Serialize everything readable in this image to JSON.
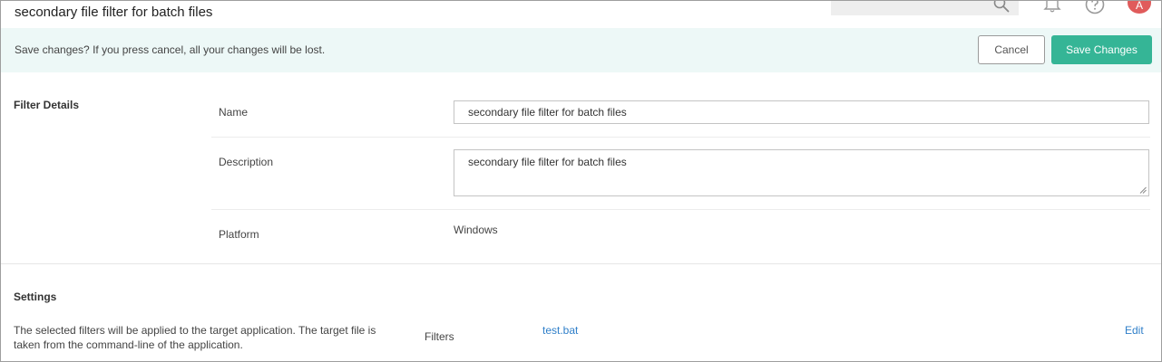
{
  "header": {
    "title": "secondary file filter for batch files",
    "avatar_initial": "A"
  },
  "save_bar": {
    "message": "Save changes? If you press cancel, all your changes will be lost.",
    "cancel_label": "Cancel",
    "save_label": "Save Changes",
    "save_color": "#35b596"
  },
  "filter_details": {
    "heading": "Filter Details",
    "name_label": "Name",
    "name_value": "secondary file filter for batch files",
    "description_label": "Description",
    "description_value": "secondary file filter for batch files",
    "platform_label": "Platform",
    "platform_value": "Windows"
  },
  "settings": {
    "heading": "Settings",
    "description": "The selected filters will be applied to the target application. The target file is taken from the command-line of the application.",
    "filters_label": "Filters",
    "filter_value": "test.bat",
    "edit_label": "Edit",
    "link_color": "#2f7fc9"
  },
  "icons": [
    "search-icon",
    "bell-icon",
    "help-icon"
  ]
}
